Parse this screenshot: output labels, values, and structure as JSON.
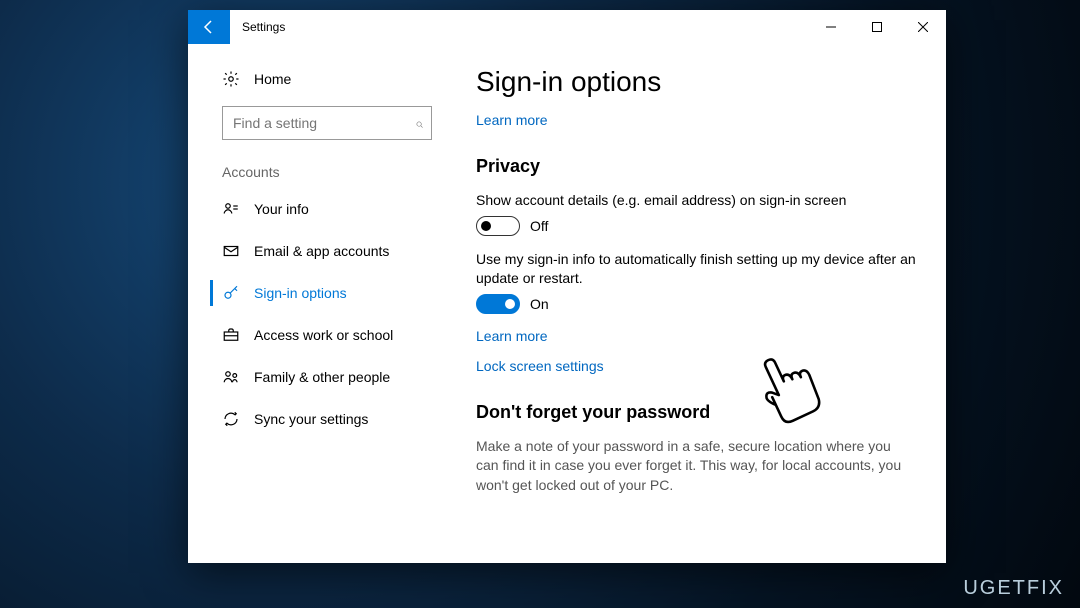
{
  "titlebar": {
    "app_title": "Settings"
  },
  "sidebar": {
    "home_label": "Home",
    "search_placeholder": "Find a setting",
    "section_label": "Accounts",
    "items": [
      {
        "label": "Your info"
      },
      {
        "label": "Email & app accounts"
      },
      {
        "label": "Sign-in options"
      },
      {
        "label": "Access work or school"
      },
      {
        "label": "Family & other people"
      },
      {
        "label": "Sync your settings"
      }
    ]
  },
  "main": {
    "page_title": "Sign-in options",
    "learn_more": "Learn more",
    "privacy_heading": "Privacy",
    "privacy_option_1": "Show account details (e.g. email address) on sign-in screen",
    "privacy_option_1_state": "Off",
    "privacy_option_2": "Use my sign-in info to automatically finish setting up my device after an update or restart.",
    "privacy_option_2_state": "On",
    "learn_more_2": "Learn more",
    "lock_link": "Lock screen settings",
    "password_heading": "Don't forget your password",
    "password_body": "Make a note of your password in a safe, secure location where you can find it in case you ever forget it. This way, for local accounts, you won't get locked out of your PC."
  },
  "watermark": "UGETFIX"
}
